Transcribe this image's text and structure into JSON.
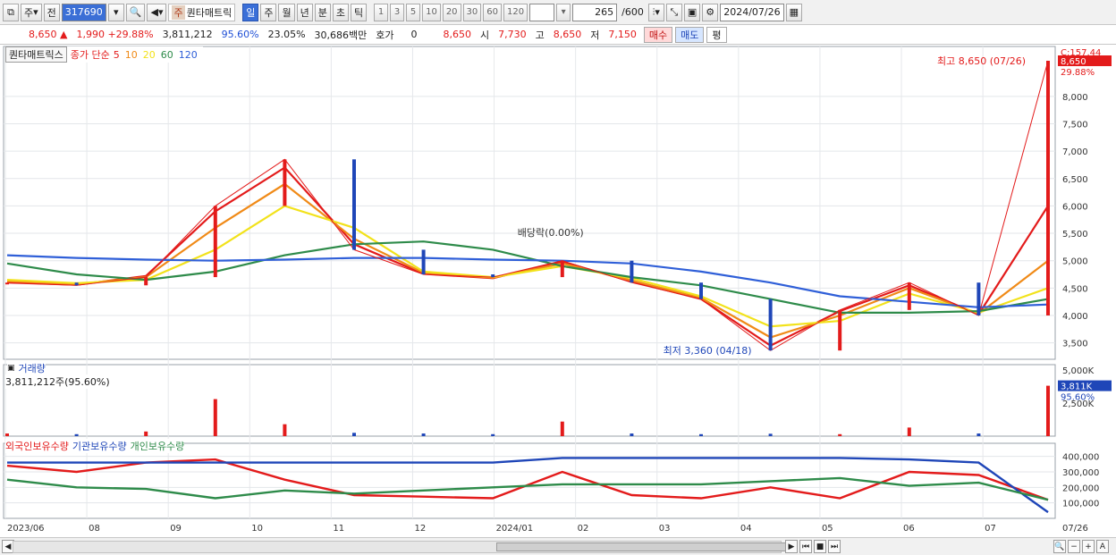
{
  "toolbar": {
    "market_type": "주",
    "prev_label": "전",
    "stock_code": "317690",
    "stock_tag": "주",
    "stock_name": "퀀타매트릭",
    "periods": [
      "일",
      "주",
      "월",
      "년",
      "분",
      "초",
      "틱"
    ],
    "intervals": [
      "1",
      "3",
      "5",
      "10",
      "20",
      "30",
      "60",
      "120"
    ],
    "count": "265",
    "count_total": "/600",
    "date": "2024/07/26"
  },
  "quote": {
    "price": "8,650",
    "change": "1,990",
    "change_pct": "+29.88%",
    "volume": "3,811,212",
    "volume_ratio": "95.60%",
    "turnover": "23.05%",
    "trade_value": "30,686백만",
    "hoga_label": "호가",
    "hoga_value": "0",
    "ask": "8,650",
    "open_label": "시",
    "open": "7,730",
    "high_label": "고",
    "high": "8,650",
    "low_label": "저",
    "low": "7,150",
    "buy_label": "매수",
    "sell_label": "매도",
    "eval_label": "평"
  },
  "legends": {
    "price": {
      "indicator": "퀀타매트릭스",
      "ma_label": "종가 단순",
      "ma_periods": [
        {
          "label": "5",
          "color": "#e31b1b"
        },
        {
          "label": "10",
          "color": "#f08a17"
        },
        {
          "label": "20",
          "color": "#f2e21b"
        },
        {
          "label": "60",
          "color": "#2e8b4a"
        },
        {
          "label": "120",
          "color": "#2f5fd8"
        }
      ]
    },
    "volume": {
      "title": "거래량",
      "readout": "3,811,212주(95.60%)"
    },
    "holdings": [
      "외국인보유수량",
      "기관보유수량",
      "개인보유수량"
    ]
  },
  "annotations": {
    "high": "최고 8,650 (07/26)",
    "low": "최저 3,360 (04/18)",
    "dividend": "배당락(0.00%)"
  },
  "right_axis": {
    "price_ticks": [
      "8,000",
      "7,500",
      "7,000",
      "6,500",
      "6,000",
      "5,500",
      "5,000",
      "4,500",
      "4,000",
      "3,500"
    ],
    "price_top_label": "C:157.44",
    "current_price_tag": "8,650",
    "current_pct_tag": "29.88%",
    "volume_ticks": [
      "5,000K",
      "2,500K"
    ],
    "volume_tag": "3,811K",
    "volume_pct_tag": "95.60%",
    "holdings_ticks": [
      "400,000",
      "300,000",
      "200,000",
      "100,000"
    ],
    "date_tag": "07/26"
  },
  "x_axis": {
    "labels": [
      "2023/06",
      "08",
      "09",
      "10",
      "11",
      "12",
      "2024/01",
      "02",
      "03",
      "04",
      "05",
      "06",
      "07"
    ]
  },
  "colors": {
    "up": "#e31b1b",
    "down": "#1f46b8",
    "ma5": "#e31b1b",
    "ma10": "#f08a17",
    "ma20": "#f2e21b",
    "ma60": "#2e8b4a",
    "ma120": "#2f5fd8",
    "foreign": "#e31b1b",
    "institution": "#1f46b8",
    "individual": "#2e8b4a"
  },
  "chart_data": {
    "type": "line",
    "title": "",
    "price_series": {
      "x": [
        "2023/06",
        "2023/07",
        "2023/08",
        "2023/09",
        "2023/09-mid",
        "2023/10",
        "2023/11",
        "2023/12",
        "2024/01",
        "2024/02",
        "2024/03",
        "2024/04-18",
        "2024/05",
        "2024/06",
        "2024/07",
        "2024/07/26"
      ],
      "close": [
        4600,
        4550,
        4700,
        6000,
        6850,
        5200,
        4750,
        4700,
        5000,
        4600,
        4300,
        3360,
        4100,
        4600,
        4000,
        8650
      ]
    },
    "series": [
      {
        "name": "5",
        "values": [
          4600,
          4560,
          4720,
          5900,
          6700,
          5300,
          4760,
          4680,
          4980,
          4620,
          4300,
          3450,
          4080,
          4550,
          4020,
          6000
        ]
      },
      {
        "name": "10",
        "values": [
          4620,
          4570,
          4700,
          5600,
          6400,
          5400,
          4780,
          4690,
          4950,
          4640,
          4320,
          3600,
          4000,
          4500,
          4030,
          5000
        ]
      },
      {
        "name": "20",
        "values": [
          4650,
          4590,
          4650,
          5200,
          6000,
          5600,
          4800,
          4700,
          4900,
          4680,
          4350,
          3800,
          3900,
          4400,
          4050,
          4500
        ]
      },
      {
        "name": "60",
        "values": [
          4950,
          4750,
          4650,
          4800,
          5100,
          5300,
          5350,
          5200,
          4900,
          4700,
          4550,
          4300,
          4050,
          4050,
          4080,
          4300
        ]
      },
      {
        "name": "120",
        "values": [
          5100,
          5050,
          5020,
          5000,
          5020,
          5050,
          5050,
          5020,
          5000,
          4950,
          4800,
          4600,
          4350,
          4250,
          4150,
          4200
        ]
      }
    ],
    "volume_k": [
      200,
      150,
      350,
      2800,
      900,
      250,
      200,
      150,
      1100,
      200,
      150,
      180,
      150,
      650,
      200,
      3811
    ],
    "holdings": {
      "foreign": [
        340000,
        300000,
        360000,
        380000,
        250000,
        150000,
        140000,
        130000,
        300000,
        150000,
        130000,
        200000,
        130000,
        300000,
        280000,
        120000
      ],
      "institution": [
        360000,
        360000,
        360000,
        360000,
        360000,
        360000,
        360000,
        360000,
        390000,
        390000,
        390000,
        390000,
        390000,
        380000,
        360000,
        40000
      ],
      "individual": [
        250000,
        200000,
        190000,
        130000,
        180000,
        160000,
        180000,
        200000,
        220000,
        220000,
        220000,
        240000,
        260000,
        210000,
        230000,
        120000
      ]
    },
    "ylim": [
      3200,
      8650
    ],
    "volume_ylim": [
      0,
      5000
    ],
    "holdings_ylim": [
      0,
      450000
    ],
    "grid": true,
    "legend": "top-left"
  }
}
